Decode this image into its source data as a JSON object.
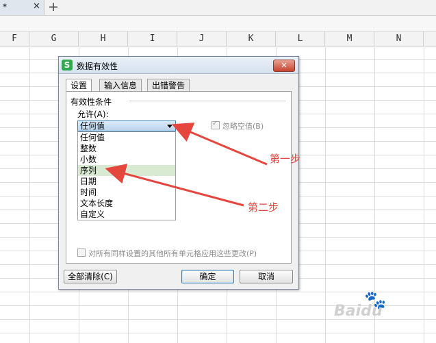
{
  "window": {
    "doc_tab_title": "*",
    "doc_tab_close": "✕",
    "new_tab_symbol": "+"
  },
  "sheet": {
    "columns": [
      "F",
      "G",
      "H",
      "I",
      "J",
      "K",
      "L",
      "M",
      "N"
    ]
  },
  "dialog": {
    "title": "数据有效性",
    "app_icon_letter": "S",
    "close_symbol": "✕",
    "tabs": [
      {
        "label": "设置",
        "active": true
      },
      {
        "label": "输入信息",
        "active": false
      },
      {
        "label": "出错警告",
        "active": false
      }
    ],
    "group_label": "有效性条件",
    "allow_label": "允许(A):",
    "allow_value": "任何值",
    "options": [
      "任何值",
      "整数",
      "小数",
      "序列",
      "日期",
      "时间",
      "文本长度",
      "自定义"
    ],
    "highlighted_option": "序列",
    "ignore_blank_label": "忽略空值(B)",
    "ignore_blank_checked": true,
    "apply_all_label": "对所有同样设置的其他所有单元格应用这些更改(P)",
    "apply_all_checked": false,
    "buttons": {
      "clear_all": "全部清除(C)",
      "ok": "确定",
      "cancel": "取消"
    }
  },
  "annotations": {
    "step1": "第一步",
    "step2": "第二步",
    "color": "#e5463e"
  },
  "watermark": {
    "brand": "Baidu",
    "icon": "paw-icon"
  }
}
